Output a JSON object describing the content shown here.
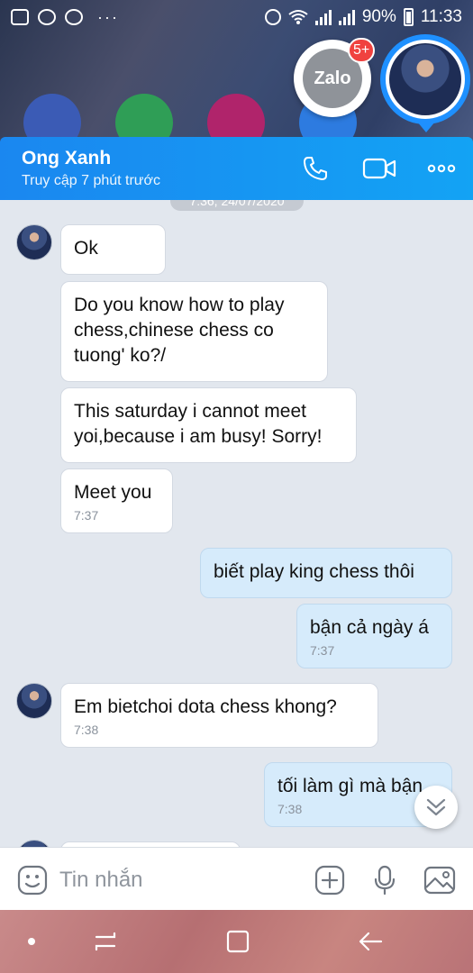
{
  "status_bar": {
    "battery": "90%",
    "time": "11:33",
    "dots": "···"
  },
  "zalo_bubble": {
    "label": "Zalo",
    "badge": "5+"
  },
  "header": {
    "contact_name": "Ong Xanh",
    "last_seen": "Truy cập 7 phút trước"
  },
  "chat": {
    "date_pill": "7:36, 24/07/2020",
    "messages": [
      {
        "text": "Ok",
        "time": ""
      },
      {
        "text": " Do you know how to play chess,chinese chess co tuong' ko?/",
        "time": ""
      },
      {
        "text": "This saturday i cannot meet yoi,because i am busy! Sorry!",
        "time": ""
      },
      {
        "text": "Meet you",
        "time": "7:37"
      },
      {
        "text": "biết play king chess thôi",
        "time": ""
      },
      {
        "text": "bận cả ngày á",
        "time": "7:37"
      },
      {
        "text": "Em bietchoi dota chess khong?",
        "time": "7:38"
      },
      {
        "text": "tối làm gì mà bận",
        "time": "7:38"
      }
    ]
  },
  "input_bar": {
    "placeholder": "Tin nhắn"
  },
  "colors": {
    "header": "#1a87f0",
    "outgoing": "#d6ebfb",
    "incoming": "#ffffff",
    "badge": "#f0423f"
  },
  "icons": [
    "sticker-icon",
    "plus-icon",
    "mic-icon",
    "image-icon",
    "phone-icon",
    "video-icon",
    "more-icon",
    "chevron-double-down-icon"
  ]
}
